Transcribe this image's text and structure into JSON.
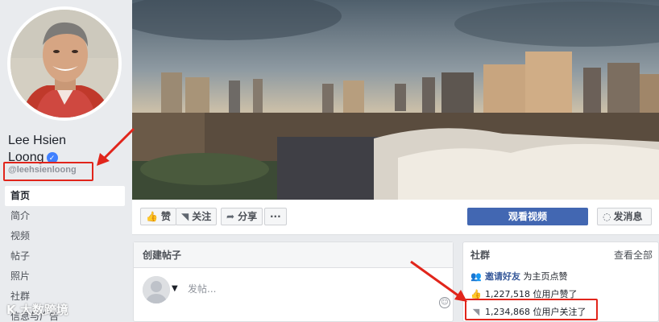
{
  "profile": {
    "name_line1": "Lee Hsien",
    "name_line2": "Loong",
    "verified_icon": "check-icon",
    "handle": "@leehsienloong"
  },
  "nav": {
    "items": [
      {
        "label": "首页",
        "active": true
      },
      {
        "label": "简介"
      },
      {
        "label": "视频"
      },
      {
        "label": "帖子"
      },
      {
        "label": "照片"
      },
      {
        "label": "社群"
      },
      {
        "label": "信息与广告"
      }
    ]
  },
  "actions": {
    "like_label": "赞",
    "follow_label": "关注",
    "share_label": "分享",
    "more_label": "···",
    "watch_video_label": "观看视频",
    "send_message_label": "发消息"
  },
  "create_post": {
    "title": "创建帖子",
    "placeholder": "发帖..."
  },
  "community": {
    "title": "社群",
    "see_all": "查看全部",
    "invite_link": "邀请好友",
    "invite_text": "为主页点赞",
    "likes_text": "1,227,518 位用户赞了",
    "follows_text": "1,234,868 位用户关注了"
  },
  "watermark": "K 大数跨境",
  "colors": {
    "accent": "#4267b2",
    "highlight": "#e1251b"
  }
}
